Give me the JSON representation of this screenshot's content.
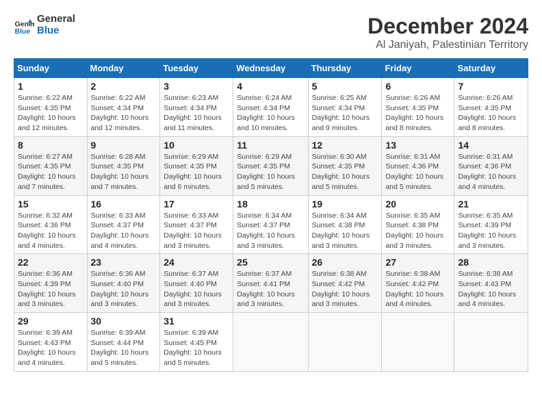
{
  "logo": {
    "line1": "General",
    "line2": "Blue"
  },
  "title": "December 2024",
  "subtitle": "Al Janiyah, Palestinian Territory",
  "days_of_week": [
    "Sunday",
    "Monday",
    "Tuesday",
    "Wednesday",
    "Thursday",
    "Friday",
    "Saturday"
  ],
  "weeks": [
    [
      {
        "day": "1",
        "info": "Sunrise: 6:22 AM\nSunset: 4:35 PM\nDaylight: 10 hours and 12 minutes."
      },
      {
        "day": "2",
        "info": "Sunrise: 6:22 AM\nSunset: 4:34 PM\nDaylight: 10 hours and 12 minutes."
      },
      {
        "day": "3",
        "info": "Sunrise: 6:23 AM\nSunset: 4:34 PM\nDaylight: 10 hours and 11 minutes."
      },
      {
        "day": "4",
        "info": "Sunrise: 6:24 AM\nSunset: 4:34 PM\nDaylight: 10 hours and 10 minutes."
      },
      {
        "day": "5",
        "info": "Sunrise: 6:25 AM\nSunset: 4:34 PM\nDaylight: 10 hours and 9 minutes."
      },
      {
        "day": "6",
        "info": "Sunrise: 6:26 AM\nSunset: 4:35 PM\nDaylight: 10 hours and 8 minutes."
      },
      {
        "day": "7",
        "info": "Sunrise: 6:26 AM\nSunset: 4:35 PM\nDaylight: 10 hours and 8 minutes."
      }
    ],
    [
      {
        "day": "8",
        "info": "Sunrise: 6:27 AM\nSunset: 4:35 PM\nDaylight: 10 hours and 7 minutes."
      },
      {
        "day": "9",
        "info": "Sunrise: 6:28 AM\nSunset: 4:35 PM\nDaylight: 10 hours and 7 minutes."
      },
      {
        "day": "10",
        "info": "Sunrise: 6:29 AM\nSunset: 4:35 PM\nDaylight: 10 hours and 6 minutes."
      },
      {
        "day": "11",
        "info": "Sunrise: 6:29 AM\nSunset: 4:35 PM\nDaylight: 10 hours and 5 minutes."
      },
      {
        "day": "12",
        "info": "Sunrise: 6:30 AM\nSunset: 4:35 PM\nDaylight: 10 hours and 5 minutes."
      },
      {
        "day": "13",
        "info": "Sunrise: 6:31 AM\nSunset: 4:36 PM\nDaylight: 10 hours and 5 minutes."
      },
      {
        "day": "14",
        "info": "Sunrise: 6:31 AM\nSunset: 4:36 PM\nDaylight: 10 hours and 4 minutes."
      }
    ],
    [
      {
        "day": "15",
        "info": "Sunrise: 6:32 AM\nSunset: 4:36 PM\nDaylight: 10 hours and 4 minutes."
      },
      {
        "day": "16",
        "info": "Sunrise: 6:33 AM\nSunset: 4:37 PM\nDaylight: 10 hours and 4 minutes."
      },
      {
        "day": "17",
        "info": "Sunrise: 6:33 AM\nSunset: 4:37 PM\nDaylight: 10 hours and 3 minutes."
      },
      {
        "day": "18",
        "info": "Sunrise: 6:34 AM\nSunset: 4:37 PM\nDaylight: 10 hours and 3 minutes."
      },
      {
        "day": "19",
        "info": "Sunrise: 6:34 AM\nSunset: 4:38 PM\nDaylight: 10 hours and 3 minutes."
      },
      {
        "day": "20",
        "info": "Sunrise: 6:35 AM\nSunset: 4:38 PM\nDaylight: 10 hours and 3 minutes."
      },
      {
        "day": "21",
        "info": "Sunrise: 6:35 AM\nSunset: 4:39 PM\nDaylight: 10 hours and 3 minutes."
      }
    ],
    [
      {
        "day": "22",
        "info": "Sunrise: 6:36 AM\nSunset: 4:39 PM\nDaylight: 10 hours and 3 minutes."
      },
      {
        "day": "23",
        "info": "Sunrise: 6:36 AM\nSunset: 4:40 PM\nDaylight: 10 hours and 3 minutes."
      },
      {
        "day": "24",
        "info": "Sunrise: 6:37 AM\nSunset: 4:40 PM\nDaylight: 10 hours and 3 minutes."
      },
      {
        "day": "25",
        "info": "Sunrise: 6:37 AM\nSunset: 4:41 PM\nDaylight: 10 hours and 3 minutes."
      },
      {
        "day": "26",
        "info": "Sunrise: 6:38 AM\nSunset: 4:42 PM\nDaylight: 10 hours and 3 minutes."
      },
      {
        "day": "27",
        "info": "Sunrise: 6:38 AM\nSunset: 4:42 PM\nDaylight: 10 hours and 4 minutes."
      },
      {
        "day": "28",
        "info": "Sunrise: 6:38 AM\nSunset: 4:43 PM\nDaylight: 10 hours and 4 minutes."
      }
    ],
    [
      {
        "day": "29",
        "info": "Sunrise: 6:39 AM\nSunset: 4:43 PM\nDaylight: 10 hours and 4 minutes."
      },
      {
        "day": "30",
        "info": "Sunrise: 6:39 AM\nSunset: 4:44 PM\nDaylight: 10 hours and 5 minutes."
      },
      {
        "day": "31",
        "info": "Sunrise: 6:39 AM\nSunset: 4:45 PM\nDaylight: 10 hours and 5 minutes."
      },
      null,
      null,
      null,
      null
    ]
  ]
}
